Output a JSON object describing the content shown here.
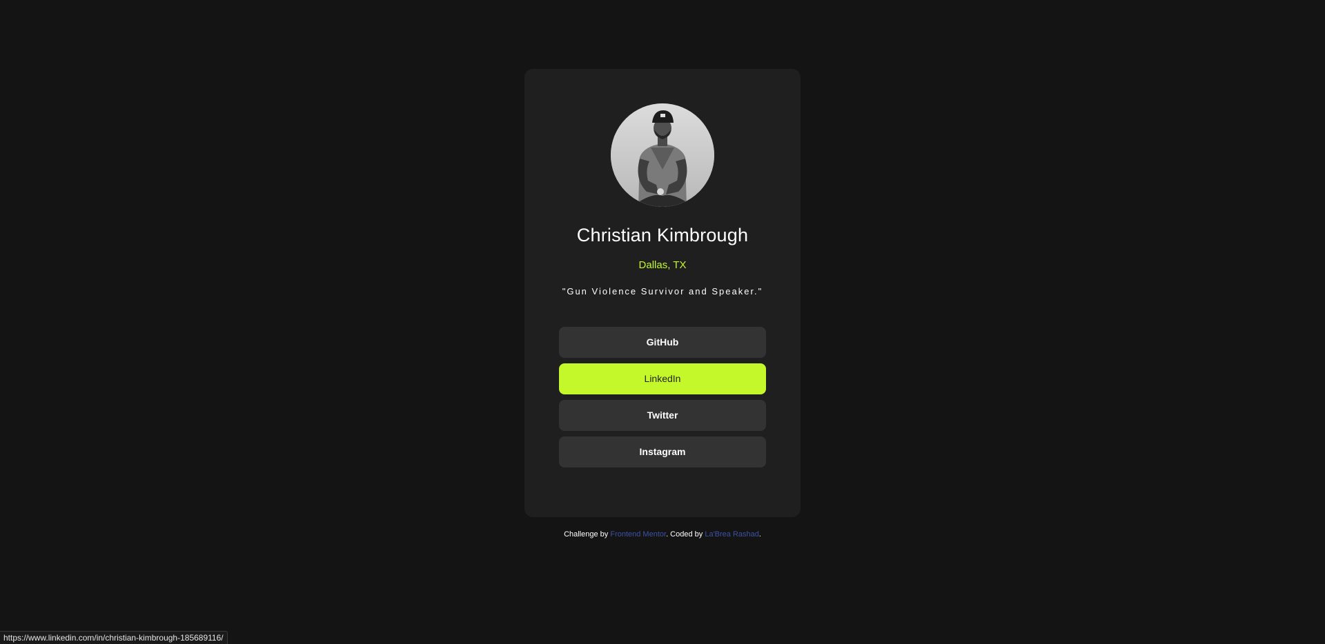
{
  "profile": {
    "avatar_icon": "person-portrait-icon",
    "name": "Christian Kimbrough",
    "location": "Dallas, TX",
    "quote": "\"Gun Violence Survivor and Speaker.\""
  },
  "links": [
    {
      "label": "GitHub",
      "active": false
    },
    {
      "label": "LinkedIn",
      "active": true
    },
    {
      "label": "Twitter",
      "active": false
    },
    {
      "label": "Instagram",
      "active": false
    }
  ],
  "footer": {
    "prefix": "Challenge by ",
    "challenge_link": "Frontend Mentor",
    "middle": ". Coded by ",
    "author_link": "La'Brea Rashad",
    "suffix": "."
  },
  "status_bar": {
    "url": "https://www.linkedin.com/in/christian-kimbrough-185689116/"
  },
  "colors": {
    "background": "#141414",
    "card": "#1f1f1f",
    "accent": "#c4f82a",
    "button": "#333333",
    "footer_link": "#3e52a3"
  }
}
